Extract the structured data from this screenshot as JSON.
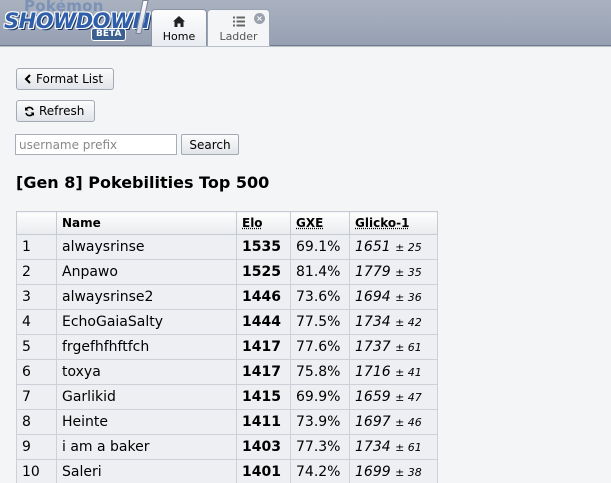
{
  "logo": {
    "top_text": "Pokémon",
    "main_text": "SHOWDOWN",
    "badge": "BETA"
  },
  "tabs": [
    {
      "label": "Home",
      "icon": "home-icon"
    },
    {
      "label": "Ladder",
      "icon": "list-icon",
      "close": "×"
    }
  ],
  "toolbar": {
    "format_list_label": "Format List",
    "refresh_label": "Refresh"
  },
  "search": {
    "placeholder": "username prefix",
    "value": "",
    "button_label": "Search"
  },
  "page_title": "[Gen 8] Pokebilities Top 500",
  "table": {
    "headers": {
      "rank": "",
      "name": "Name",
      "elo": "Elo",
      "gxe": "GXE",
      "glicko": "Glicko-1"
    },
    "rows": [
      {
        "rank": "1",
        "name": "alwaysrinse",
        "elo": "1535",
        "gxe": "69.1%",
        "glicko": "1651",
        "dev": "± 25"
      },
      {
        "rank": "2",
        "name": "Anpawo",
        "elo": "1525",
        "gxe": "81.4%",
        "glicko": "1779",
        "dev": "± 35"
      },
      {
        "rank": "3",
        "name": "alwaysrinse2",
        "elo": "1446",
        "gxe": "73.6%",
        "glicko": "1694",
        "dev": "± 36"
      },
      {
        "rank": "4",
        "name": "EchoGaiaSalty",
        "elo": "1444",
        "gxe": "77.5%",
        "glicko": "1734",
        "dev": "± 42"
      },
      {
        "rank": "5",
        "name": "frgefhfhftfch",
        "elo": "1417",
        "gxe": "77.6%",
        "glicko": "1737",
        "dev": "± 61"
      },
      {
        "rank": "6",
        "name": "toxya",
        "elo": "1417",
        "gxe": "75.8%",
        "glicko": "1716",
        "dev": "± 41"
      },
      {
        "rank": "7",
        "name": "Garlikid",
        "elo": "1415",
        "gxe": "69.9%",
        "glicko": "1659",
        "dev": "± 47"
      },
      {
        "rank": "8",
        "name": "Heinte",
        "elo": "1411",
        "gxe": "73.9%",
        "glicko": "1697",
        "dev": "± 46"
      },
      {
        "rank": "9",
        "name": "i am a baker",
        "elo": "1403",
        "gxe": "77.3%",
        "glicko": "1734",
        "dev": "± 61"
      },
      {
        "rank": "10",
        "name": "Saleri",
        "elo": "1401",
        "gxe": "74.2%",
        "glicko": "1699",
        "dev": "± 38"
      }
    ]
  }
}
